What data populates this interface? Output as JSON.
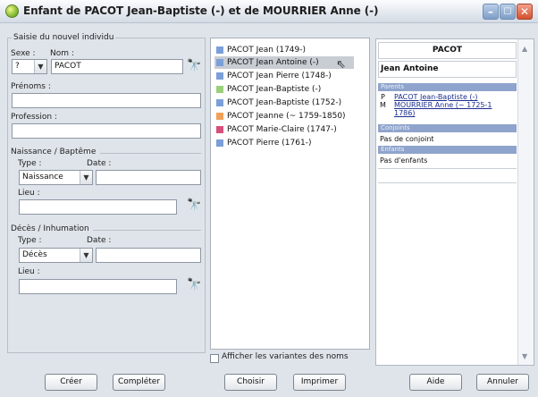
{
  "window": {
    "title": "Enfant de PACOT Jean-Baptiste (-) et de MOURRIER Anne (-)"
  },
  "form": {
    "section_title": "Saisie du nouvel individu",
    "sexe_label": "Sexe :",
    "sexe_value": "?",
    "nom_label": "Nom :",
    "nom_value": "PACOT",
    "prenoms_label": "Prénoms :",
    "prenoms_value": "",
    "profession_label": "Profession :",
    "profession_value": "",
    "naissance": {
      "title": "Naissance / Baptême",
      "type_label": "Type :",
      "type_value": "Naissance",
      "date_label": "Date :",
      "date_value": "",
      "lieu_label": "Lieu :",
      "lieu_value": ""
    },
    "deces": {
      "title": "Décès / Inhumation",
      "type_label": "Type :",
      "type_value": "Décès",
      "date_label": "Date :",
      "date_value": "",
      "lieu_label": "Lieu :",
      "lieu_value": ""
    }
  },
  "list": {
    "items": [
      {
        "label": "PACOT Jean (1749-)",
        "color": "#7b9fd8"
      },
      {
        "label": "PACOT Jean Antoine (-)",
        "color": "#7b9fd8"
      },
      {
        "label": "PACOT Jean Pierre (1748-)",
        "color": "#7b9fd8"
      },
      {
        "label": "PACOT Jean-Baptiste (-)",
        "color": "#9bd07a"
      },
      {
        "label": "PACOT Jean-Baptiste (1752-)",
        "color": "#7b9fd8"
      },
      {
        "label": "PACOT Jeanne (~ 1759-1850)",
        "color": "#f0a05a"
      },
      {
        "label": "PACOT Marie-Claire (1747-)",
        "color": "#d8507a"
      },
      {
        "label": "PACOT Pierre (1761-)",
        "color": "#7b9fd8"
      }
    ],
    "selected_index": 1,
    "variants_label": "Afficher les variantes des noms"
  },
  "detail": {
    "surname": "PACOT",
    "given_name": "Jean Antoine",
    "parents_header": "Parents",
    "father_prefix": "P",
    "father": "PACOT Jean-Baptiste (-)",
    "mother_prefix": "M",
    "mother_line1": "MOURRIER  Anne  (~  1725-1",
    "mother_line2": "1786)",
    "conjoints_header": "Conjoints",
    "conjoints_text": "Pas de conjoint",
    "enfants_header": "Enfants",
    "enfants_text": "Pas d'enfants"
  },
  "buttons": {
    "creer": "Créer",
    "completer": "Compléter",
    "choisir": "Choisir",
    "imprimer": "Imprimer",
    "aide": "Aide",
    "annuler": "Annuler"
  },
  "icons": {
    "binoculars": "binoculars-icon",
    "app": "app-icon"
  }
}
